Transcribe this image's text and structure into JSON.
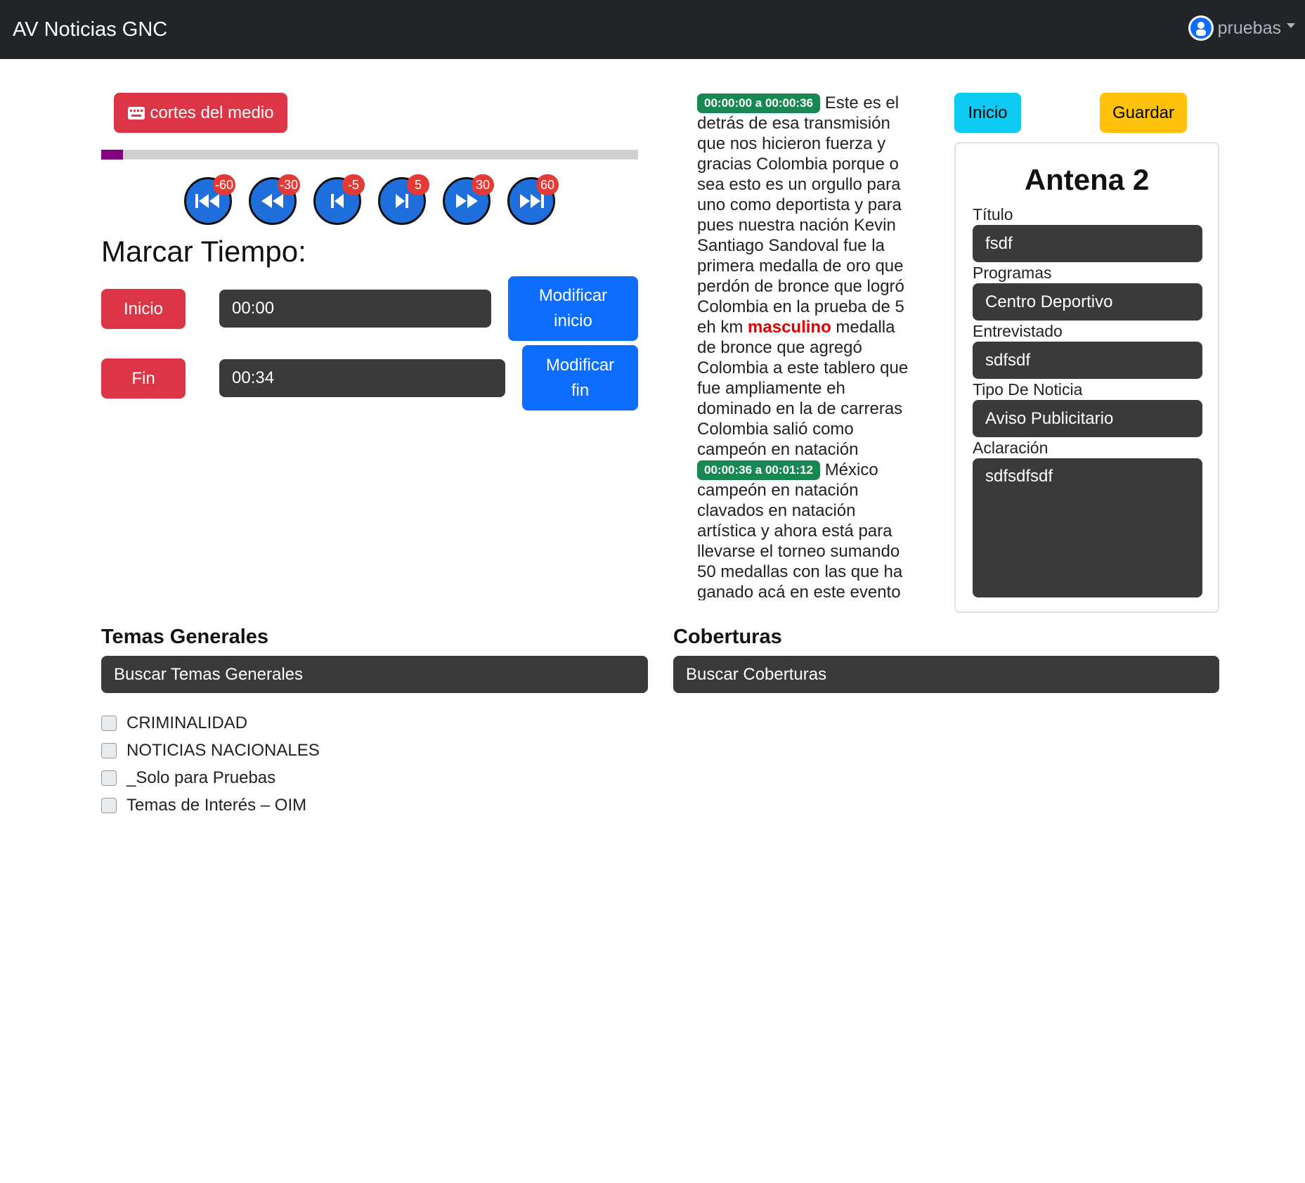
{
  "navbar": {
    "brand": "AV Noticias GNC",
    "user": "pruebas"
  },
  "player": {
    "cortes_label": "cortes del medio",
    "progress_fraction": 0.04,
    "controls": [
      {
        "name": "rewind-60",
        "badge": "-60",
        "icon": "skip-back-icon"
      },
      {
        "name": "rewind-30",
        "badge": "-30",
        "icon": "rewind-icon"
      },
      {
        "name": "rewind-5",
        "badge": "-5",
        "icon": "step-back-icon"
      },
      {
        "name": "forward-5",
        "badge": "5",
        "icon": "step-forward-icon"
      },
      {
        "name": "forward-30",
        "badge": "30",
        "icon": "fast-forward-icon"
      },
      {
        "name": "forward-60",
        "badge": "60",
        "icon": "skip-forward-icon"
      }
    ]
  },
  "marcar": {
    "heading": "Marcar Tiempo:",
    "inicio_label": "Inicio",
    "inicio_value": "00:00",
    "modificar_inicio": "Modificar inicio",
    "fin_label": "Fin",
    "fin_value": "00:34",
    "modificar_fin": "Modificar fin"
  },
  "transcript": {
    "seg1_time": "00:00:00 a 00:00:36",
    "seg1_text_a": "Este es el detrás de esa transmisión que nos hicieron fuerza y gracias Colombia porque o sea esto es un orgullo para uno como deportista y para pues nuestra nación Kevin Santiago Sandoval fue la primera medalla de oro que perdón de bronce que logró Colombia en la prueba de 5 eh km",
    "seg1_highlight": "masculino",
    "seg1_text_b": "medalla de bronce que agregó Colombia a este tablero que fue ampliamente eh dominado en la de carreras Colombia salió como campeón en natación",
    "seg2_time": "00:00:36 a 00:01:12",
    "seg2_text": "México campeón en natación clavados en natación artística y ahora está para llevarse el torneo sumando 50 medallas con las que ha ganado acá en este evento"
  },
  "actions": {
    "inicio": "Inicio",
    "guardar": "Guardar"
  },
  "form": {
    "title": "Antena 2",
    "titulo_label": "Título",
    "titulo_value": "fsdf",
    "programas_label": "Programas",
    "programas_value": "Centro Deportivo",
    "entrevistado_label": "Entrevistado",
    "entrevistado_value": "sdfsdf",
    "tipo_label": "Tipo De Noticia",
    "tipo_value": "Aviso Publicitario",
    "aclaracion_label": "Aclaración",
    "aclaracion_value": "sdfsdfsdf"
  },
  "temas": {
    "heading": "Temas Generales",
    "search_placeholder": "Buscar Temas Generales",
    "items": [
      "CRIMINALIDAD",
      "NOTICIAS NACIONALES",
      "_Solo para Pruebas",
      "Temas de Interés – OIM"
    ]
  },
  "coberturas": {
    "heading": "Coberturas",
    "search_placeholder": "Buscar Coberturas"
  },
  "colors": {
    "navbar": "#212529",
    "danger": "#dc3545",
    "primary": "#0d6efd",
    "info": "#0dcaf0",
    "warning": "#ffc107",
    "success": "#198754",
    "progress": "#800080",
    "control": "#1e6fdc"
  }
}
